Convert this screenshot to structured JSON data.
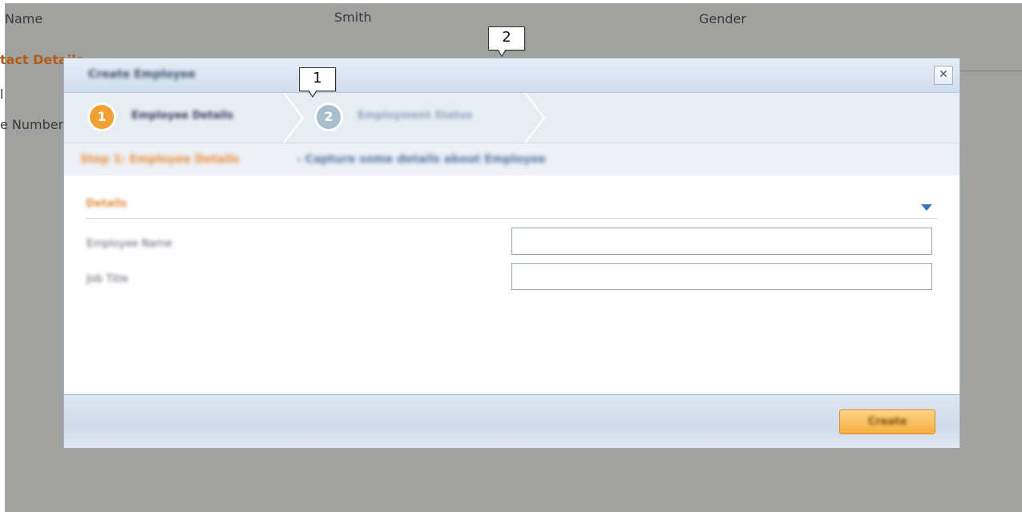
{
  "background": {
    "col_name_label": "Name",
    "col_name_value": "Smith",
    "col_gender_label": "Gender",
    "section_heading": "tact Details",
    "row_label_1": "l",
    "row_label_2": "e Number"
  },
  "callouts": [
    {
      "number": "1"
    },
    {
      "number": "2"
    }
  ],
  "dialog": {
    "title": "Create Employee",
    "close_glyph": "✕",
    "steps": [
      {
        "number": "1",
        "label": "Employee Details",
        "state": "active"
      },
      {
        "number": "2",
        "label": "Employment Status",
        "state": "inactive"
      }
    ],
    "breadcrumb": {
      "current": "Step 1: Employee Details",
      "description": " - Capture some details about Employee"
    },
    "section": {
      "title": "Details"
    },
    "fields": [
      {
        "label": "Employee Name",
        "value": ""
      },
      {
        "label": "Job Title",
        "value": ""
      }
    ],
    "footer": {
      "action_label": "Create"
    }
  },
  "colors": {
    "accent_orange": "#f0a035",
    "accent_blue": "#3077b8",
    "overlay_gray": "#a1a2a0"
  },
  "icons": {
    "close": "close-icon",
    "section_toggle": "chevron-down-icon"
  }
}
